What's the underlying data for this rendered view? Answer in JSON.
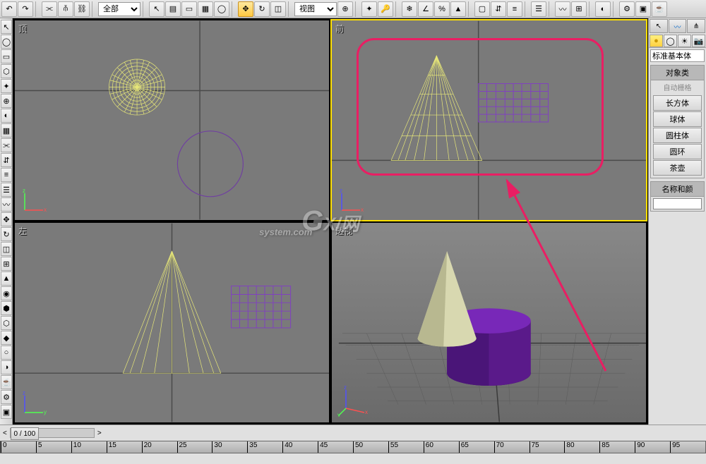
{
  "toolbar": {
    "selection_filter": "全部",
    "view_label": "视图"
  },
  "viewports": {
    "top": {
      "label": "顶"
    },
    "front": {
      "label": "前"
    },
    "left": {
      "label": "左"
    },
    "perspective": {
      "label": "透视"
    }
  },
  "right_panel": {
    "category": "标准基本体",
    "rollout_object_type": "对象类",
    "autogrid_label": "自动栅格",
    "buttons": {
      "box": "长方体",
      "sphere": "球体",
      "cylinder": "圆柱体",
      "torus": "圆环",
      "teapot": "茶壶"
    },
    "rollout_name_color": "名称和颜",
    "name_value": ""
  },
  "timeline": {
    "frame_display": "0 / 100",
    "ruler_marks": [
      0,
      5,
      10,
      15,
      20,
      25,
      30,
      35,
      40,
      45,
      50,
      55,
      60,
      65,
      70,
      75,
      80,
      85,
      90,
      95
    ]
  },
  "watermark": {
    "text1": "G",
    "text2": "X/",
    "text3": "网",
    "sub": "system.com"
  },
  "icons": {
    "undo": "↶",
    "redo": "↷",
    "link": "⫘",
    "select": "▭",
    "arrow": "↖",
    "move": "✥",
    "rotate": "↻",
    "scale": "◫",
    "snap": "⬡",
    "angle": "∠",
    "percent": "%",
    "mirror": "⇵",
    "align": "≡",
    "layer": "☰",
    "curve": "〰",
    "material": "◐",
    "render": "☕",
    "hammer": "🔨",
    "sphere": "●"
  }
}
